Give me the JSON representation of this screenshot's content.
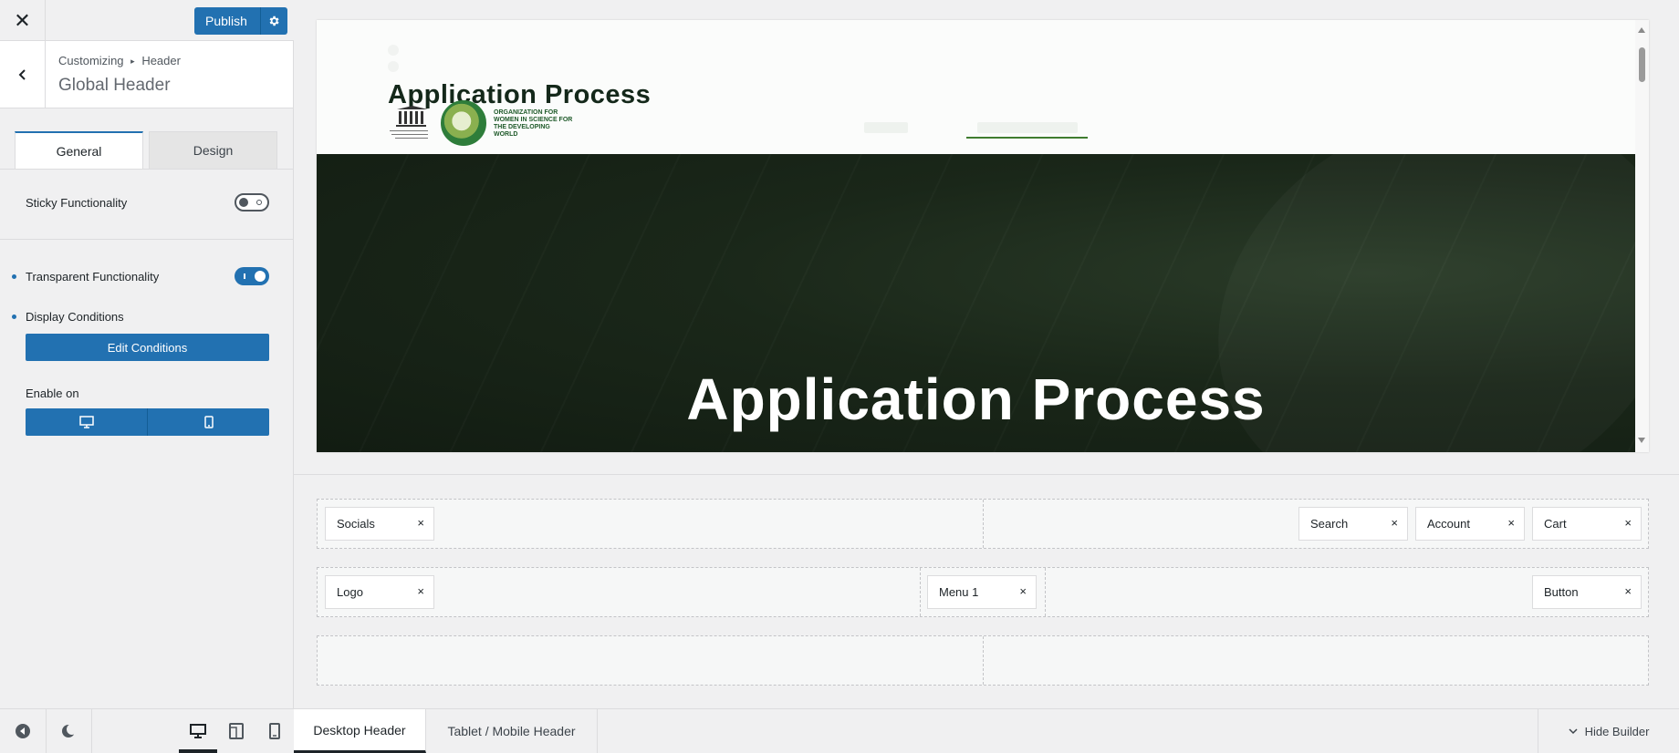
{
  "topbar": {
    "close_icon": "close-icon",
    "publish_label": "Publish",
    "publish_settings_icon": "gear-icon"
  },
  "section": {
    "breadcrumb_root": "Customizing",
    "breadcrumb_separator": "▸",
    "breadcrumb_current": "Header",
    "title": "Global Header"
  },
  "tabs": {
    "general": "General",
    "design": "Design"
  },
  "settings": {
    "sticky_label": "Sticky Functionality",
    "sticky_enabled": false,
    "transparent_label": "Transparent Functionality",
    "transparent_enabled": true,
    "display_conditions_label": "Display Conditions",
    "edit_conditions_label": "Edit Conditions",
    "enable_on_label": "Enable on",
    "enable_on_devices": [
      "desktop-icon",
      "mobile-icon"
    ]
  },
  "sidebar_footer": {
    "icons": [
      "collapse-icon",
      "dark-mode-icon",
      "desktop-icon",
      "tablet-icon",
      "mobile-icon"
    ],
    "active_device": "desktop"
  },
  "preview": {
    "site_title": "Application Process",
    "logo_text": "ORGANIZATION FOR WOMEN IN SCIENCE FOR THE DEVELOPING WORLD",
    "unesco_text": "United Nations Educational, Scientific and Cultural Organization",
    "hero_title": "Application Process",
    "accent_color": "#3f7d2f"
  },
  "builder": {
    "rows": [
      {
        "zones": [
          {
            "items": [
              "Socials"
            ]
          },
          {
            "items": [
              "Search",
              "Account",
              "Cart"
            ]
          }
        ]
      },
      {
        "zones": [
          {
            "items": [
              "Logo"
            ]
          },
          {
            "items": [
              "Menu 1"
            ]
          },
          {
            "items": [
              "Button"
            ]
          }
        ]
      },
      {
        "zones": [
          {
            "items": []
          },
          {
            "items": []
          }
        ]
      }
    ],
    "remove_glyph": "×"
  },
  "bottombar": {
    "desktop_tab": "Desktop Header",
    "mobile_tab": "Tablet / Mobile Header",
    "hide_builder": "Hide Builder"
  },
  "colors": {
    "primary": "#2271b1",
    "sidebar_bg": "#f0f0f1",
    "hero_bg": "#1a2719"
  }
}
